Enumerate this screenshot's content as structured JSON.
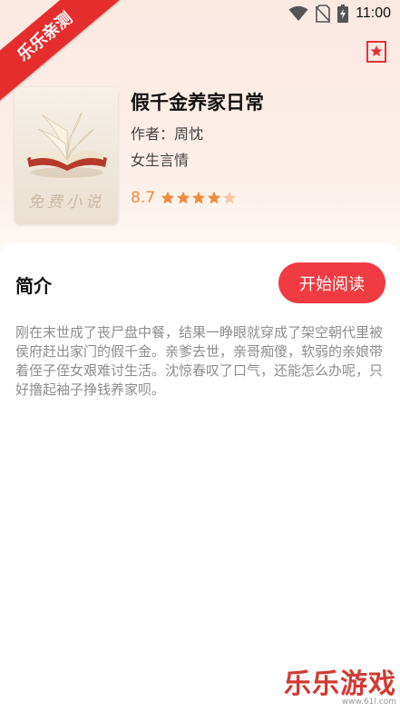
{
  "status_bar": {
    "time": "11:00"
  },
  "ribbon": {
    "text": "乐乐亲测"
  },
  "book": {
    "title": "假千金养家日常",
    "author": "作者：周忱",
    "category": "女生言情",
    "cover_text": "免费小说",
    "rating": "8.7",
    "stars_filled": 4,
    "stars_total": 5
  },
  "intro": {
    "heading": "简介",
    "read_button": "开始阅读",
    "synopsis": "刚在末世成了丧尸盘中餐，结果一睁眼就穿成了架空朝代里被侯府赶出家门的假千金。亲爹去世，亲哥痴傻，软弱的亲娘带着侄子侄女艰难讨生活。沈惊春叹了口气，还能怎么办呢，只好撸起袖子挣钱养家呗。"
  },
  "watermark": {
    "logo": "乐乐游戏",
    "url": "www.61l.com"
  },
  "colors": {
    "accent": "#ef3b41",
    "rating": "#f08a3c",
    "ribbon": "#e62d2d"
  },
  "icons": [
    "wifi-icon",
    "no-sim-icon",
    "battery-icon",
    "bookmark-star-icon",
    "star-icon",
    "book-icon"
  ]
}
